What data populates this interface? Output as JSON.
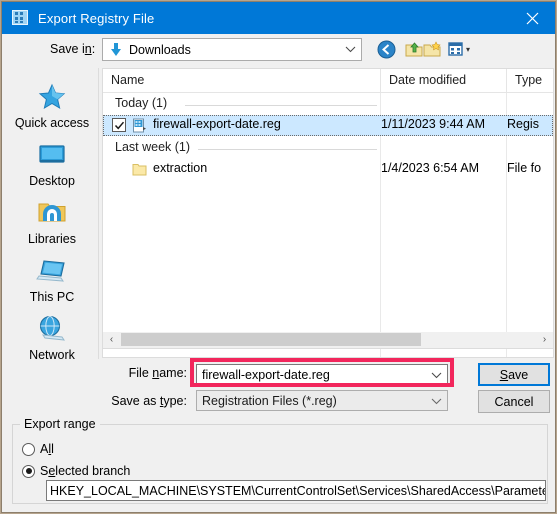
{
  "window": {
    "title": "Export Registry File",
    "icon": "registry-editor-icon",
    "close_label": "✕",
    "accent_color": "#0078d7",
    "highlight_color": "#f2265c"
  },
  "savein": {
    "label_pre": "Save i",
    "label_accel": "n",
    "label_post": ":",
    "value": "Downloads",
    "icon": "downloads-arrow-icon",
    "dropdown_arrow": "⌄"
  },
  "toolbar": {
    "back": "back-icon",
    "up": "up-one-level-icon",
    "new_folder": "new-folder-icon",
    "views": "views-icon",
    "views_arrow": "▾"
  },
  "places": [
    {
      "label": "Quick access",
      "icon": "quick-access-star-icon"
    },
    {
      "label": "Desktop",
      "icon": "desktop-monitor-icon"
    },
    {
      "label": "Libraries",
      "icon": "libraries-folder-icon"
    },
    {
      "label": "This PC",
      "icon": "this-pc-laptop-icon"
    },
    {
      "label": "Network",
      "icon": "network-globe-icon"
    }
  ],
  "filelist": {
    "columns": [
      {
        "label": "Name"
      },
      {
        "label": "Date modified"
      },
      {
        "label": "Type"
      }
    ],
    "sort_caret": "⌄",
    "groups": [
      {
        "header": "Today (1)",
        "rows": [
          {
            "name": "firewall-export-date.reg",
            "date": "1/11/2023 9:44 AM",
            "type": "Regis",
            "icon": "reg-file-icon",
            "selected": true,
            "checked": true
          }
        ]
      },
      {
        "header": "Last week (1)",
        "rows": [
          {
            "name": "extraction",
            "date": "1/4/2023 6:54 AM",
            "type": "File fo",
            "icon": "folder-icon",
            "selected": false,
            "checked": false
          }
        ]
      }
    ]
  },
  "scrollbar": {
    "left_arrow": "‹",
    "right_arrow": "›"
  },
  "fields": {
    "filename_label_pre": "File ",
    "filename_label_accel": "n",
    "filename_label_post": "ame:",
    "filename_value": "firewall-export-date.reg",
    "filename_arrow": "⌄",
    "savetype_label_pre": "Save as ",
    "savetype_label_accel": "t",
    "savetype_label_post": "ype:",
    "savetype_value": "Registration Files (*.reg)",
    "savetype_arrow": "⌄"
  },
  "buttons": {
    "save_accel": "S",
    "save_rest": "ave",
    "cancel": "Cancel"
  },
  "export_range": {
    "legend": "Export range",
    "options": [
      {
        "label_pre": "A",
        "label_accel": "l",
        "label_post": "l",
        "selected": false,
        "name": "all"
      },
      {
        "label_pre": "S",
        "label_accel": "e",
        "label_post": "lected branch",
        "selected": true,
        "name": "selected-branch"
      }
    ],
    "path": "HKEY_LOCAL_MACHINE\\SYSTEM\\CurrentControlSet\\Services\\SharedAccess\\Parameters\\FirewallP"
  }
}
